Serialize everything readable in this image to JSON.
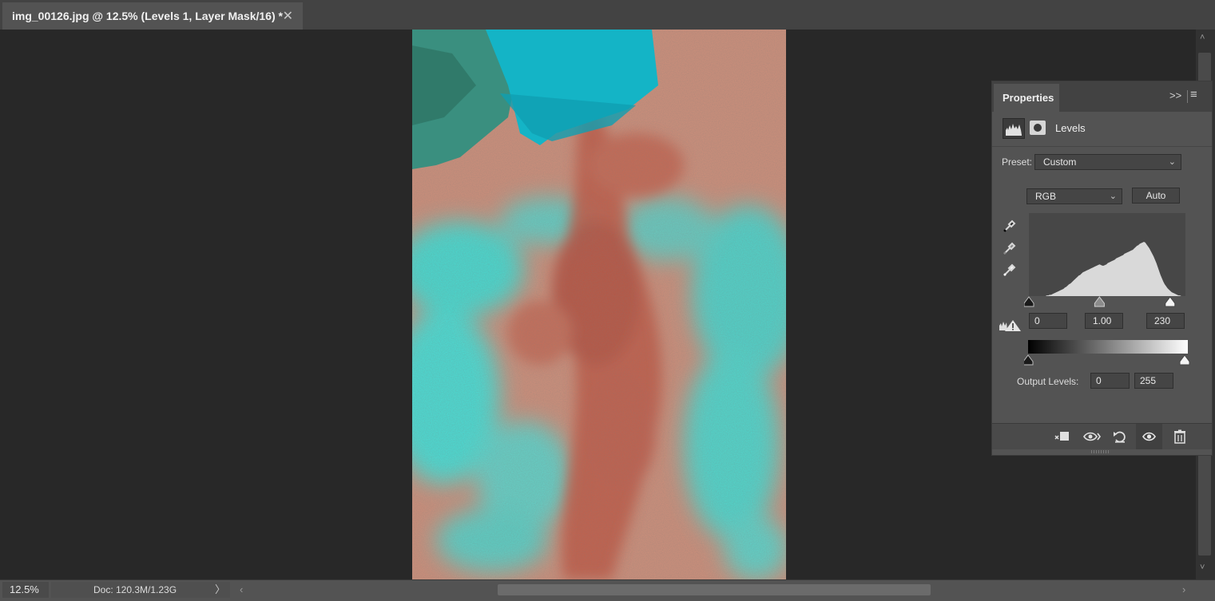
{
  "document_tab": {
    "title": "img_00126.jpg @ 12.5% (Levels 1, Layer Mask/16) *",
    "close_glyph": "✕"
  },
  "status": {
    "zoom": "12.5%",
    "doc": "Doc: 120.3M/1.23G",
    "doc_chevron": "〉"
  },
  "scroll": {
    "up": "˄",
    "down": "˅",
    "left": "‹",
    "right": "›"
  },
  "properties": {
    "tab_label": "Properties",
    "expand_glyph": ">>",
    "menu_glyph": "≡",
    "adjustment_title": "Levels",
    "preset_label": "Preset:",
    "preset_value": "Custom",
    "channel_value": "RGB",
    "auto_label": "Auto",
    "input_black": "0",
    "input_gamma": "1.00",
    "input_white": "230",
    "output_label": "Output Levels:",
    "output_black": "0",
    "output_white": "255",
    "dropdown_glyph": "⌄"
  },
  "histogram": {
    "bins": [
      0,
      0,
      0,
      0,
      0,
      0,
      0,
      0,
      0,
      0,
      0,
      0,
      0,
      1,
      1,
      2,
      2,
      3,
      4,
      5,
      6,
      7,
      8,
      9,
      10,
      11,
      13,
      14,
      16,
      18,
      19,
      21,
      23,
      25,
      27,
      29,
      31,
      32,
      34,
      36,
      37,
      38,
      39,
      40,
      41,
      42,
      43,
      44,
      45,
      46,
      47,
      48,
      47,
      46,
      46,
      47,
      48,
      50,
      51,
      52,
      53,
      54,
      55,
      57,
      58,
      59,
      60,
      61,
      62,
      64,
      65,
      66,
      67,
      68,
      69,
      70,
      72,
      74,
      76,
      77,
      79,
      80,
      81,
      82,
      81,
      78,
      75,
      72,
      68,
      64,
      60,
      55,
      50,
      44,
      38,
      32,
      27,
      22,
      18,
      15,
      12,
      10,
      8,
      6,
      5,
      4,
      3,
      2,
      1,
      1,
      0,
      0,
      0,
      0
    ],
    "input_black_level": 0,
    "input_white_level": 230,
    "gamma": 1.0,
    "output_black_level": 0,
    "output_white_level": 255
  },
  "colors": {
    "panel_bg": "#535353",
    "histogram_fill": "#d9d9d9",
    "canvas_bg": "#282828"
  }
}
